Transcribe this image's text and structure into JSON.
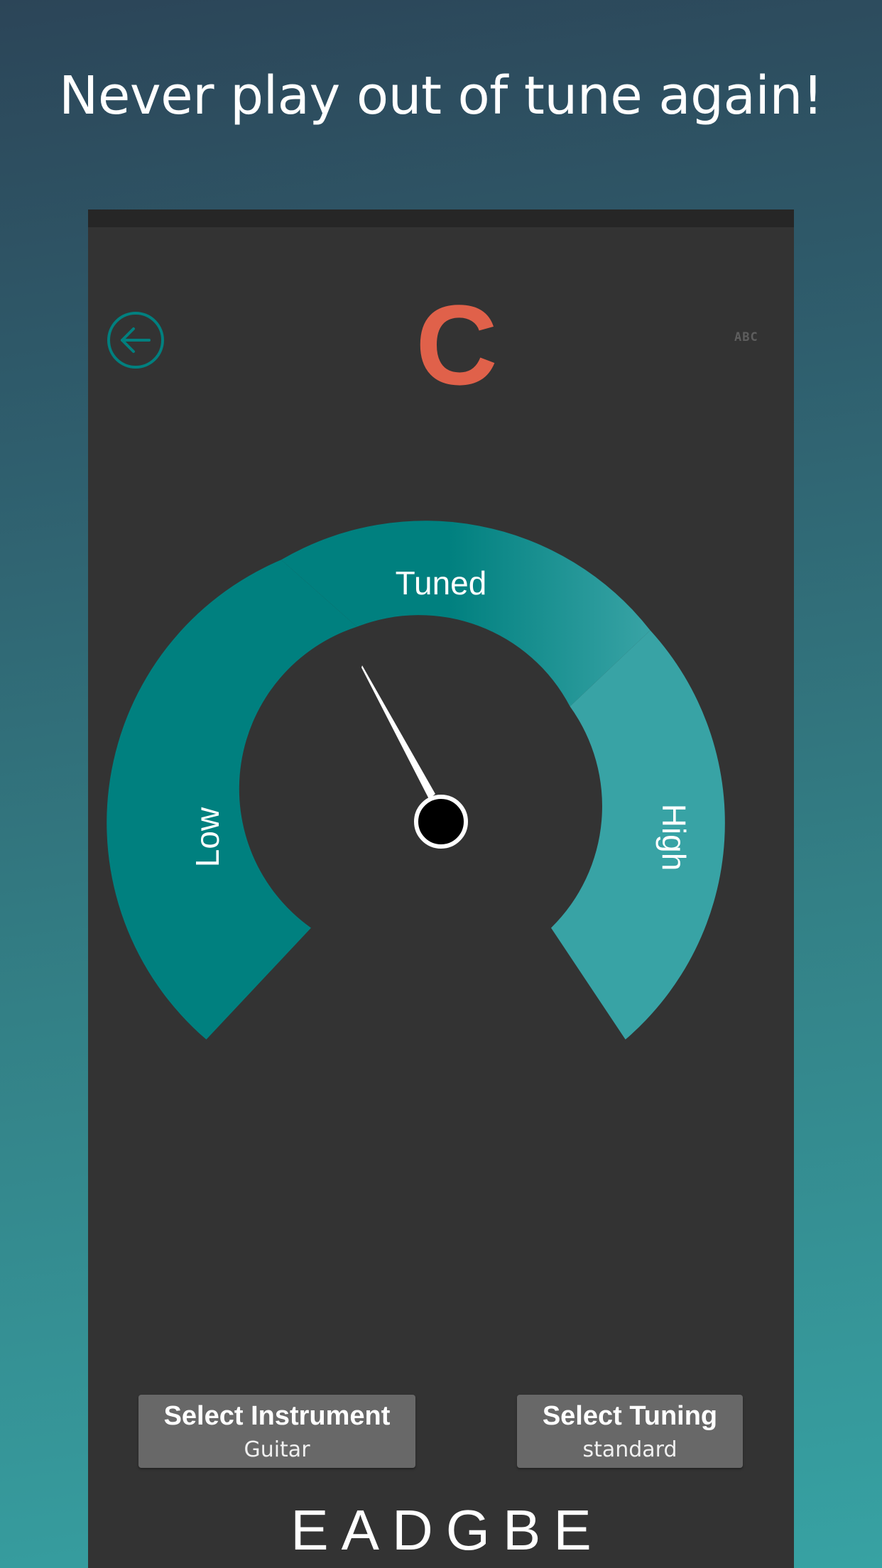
{
  "headline": "Never play out of tune again!",
  "tuner": {
    "note": "C",
    "notation_toggle": "ABC",
    "gauge": {
      "low_label": "Low",
      "tuned_label": "Tuned",
      "high_label": "High"
    }
  },
  "controls": {
    "instrument": {
      "label": "Select Instrument",
      "value": "Guitar"
    },
    "tuning": {
      "label": "Select Tuning",
      "value": "standard"
    }
  },
  "strings": [
    "E",
    "A",
    "D",
    "G",
    "B",
    "E"
  ],
  "colors": {
    "accent": "#00807f",
    "accent_light": "#38a3a5",
    "note": "#e0614a",
    "panel": "#333333"
  },
  "icons": {
    "back": "arrow-left-circle-icon"
  }
}
